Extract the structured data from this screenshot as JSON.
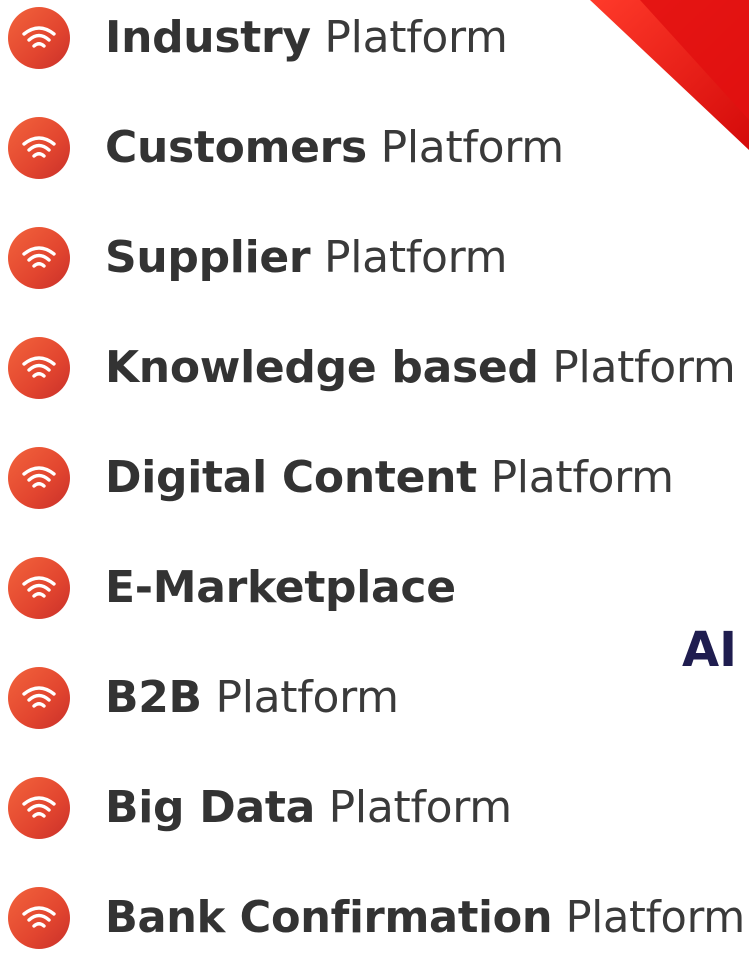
{
  "colors": {
    "icon": "#e4492f",
    "text": "#333333",
    "ai": "#1f1d4f",
    "corner": "#e01010"
  },
  "icon_name": "wifi-icon",
  "items": [
    {
      "bold": "Industry",
      "light": "Platform"
    },
    {
      "bold": "Customers",
      "light": "Platform"
    },
    {
      "bold": "Supplier",
      "light": "Platform"
    },
    {
      "bold": "Knowledge based",
      "light": "Platform"
    },
    {
      "bold": "Digital Content",
      "light": "Platform"
    },
    {
      "bold": "E-Marketplace",
      "light": ""
    },
    {
      "bold": "B2B",
      "light": "Platform"
    },
    {
      "bold": "Big Data",
      "light": "Platform"
    },
    {
      "bold": "Bank Confirmation",
      "light": "Platform"
    }
  ],
  "side_label": "AI"
}
